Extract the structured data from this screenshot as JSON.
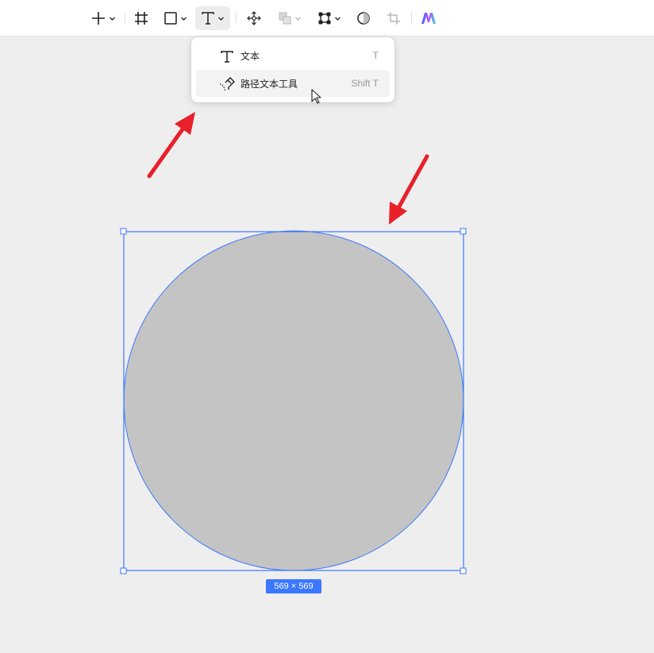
{
  "toolbar": {
    "tools": [
      {
        "name": "add-icon",
        "has_dropdown": true
      },
      {
        "name": "frame-icon",
        "has_dropdown": false
      },
      {
        "name": "rectangle-icon",
        "has_dropdown": true
      },
      {
        "name": "text-icon",
        "has_dropdown": true,
        "active": true
      },
      {
        "name": "move-icon",
        "has_dropdown": false
      },
      {
        "name": "boolean-icon",
        "has_dropdown": true,
        "disabled": true
      },
      {
        "name": "component-icon",
        "has_dropdown": true
      },
      {
        "name": "mask-icon",
        "has_dropdown": false
      },
      {
        "name": "crop-icon",
        "has_dropdown": false,
        "disabled": true
      },
      {
        "name": "ai-logo-icon",
        "has_dropdown": false
      }
    ]
  },
  "text_menu": {
    "items": [
      {
        "label": "文本",
        "shortcut": "T",
        "icon": "text-icon"
      },
      {
        "label": "路径文本工具",
        "shortcut": "Shift T",
        "icon": "path-text-icon",
        "hovered": true
      }
    ]
  },
  "canvas": {
    "selection_size_label": "569 × 569",
    "shape_fill": "#c4c4c4",
    "selection_color": "#3b78ff",
    "annotation_color": "#e8202a"
  }
}
